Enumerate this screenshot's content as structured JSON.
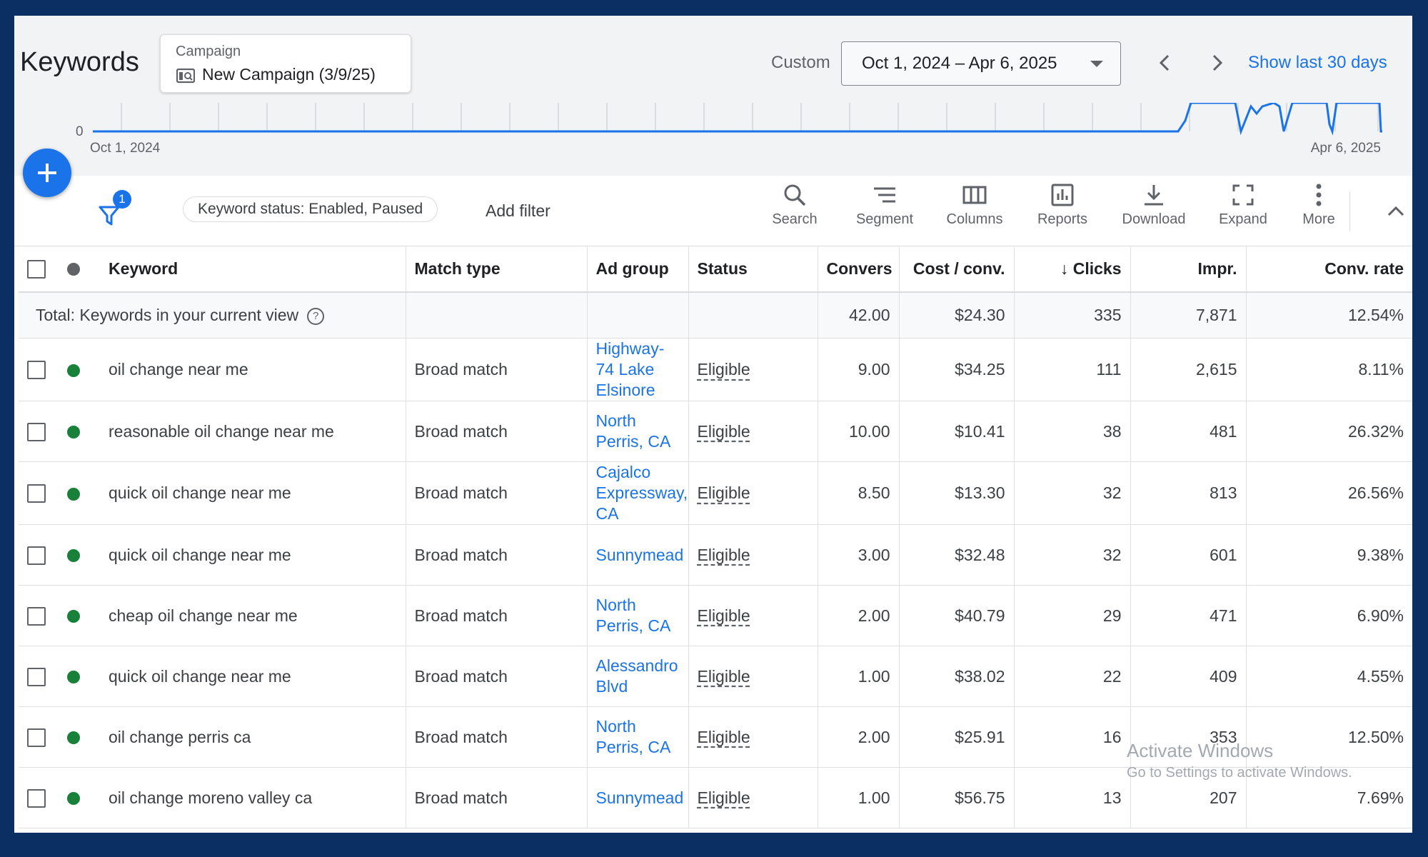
{
  "header": {
    "title": "Keywords",
    "campaign_label": "Campaign",
    "campaign_name": "New Campaign (3/9/25)",
    "custom_label": "Custom",
    "date_range": "Oct 1, 2024 – Apr 6, 2025",
    "show_last": "Show last 30 days"
  },
  "chart": {
    "y_zero": "0",
    "x_start": "Oct 1, 2024",
    "x_end": "Apr 6, 2025",
    "line_color": "#1a73e8"
  },
  "toolbar": {
    "filter_count": "1",
    "filter_chip": "Keyword status: Enabled, Paused",
    "add_filter": "Add filter",
    "tools": [
      "Search",
      "Segment",
      "Columns",
      "Reports",
      "Download",
      "Expand",
      "More"
    ]
  },
  "table": {
    "columns": [
      "Keyword",
      "Match type",
      "Ad group",
      "Status",
      "Convers",
      "Cost / conv.",
      "Clicks",
      "Impr.",
      "Conv. rate"
    ],
    "total": {
      "label": "Total: Keywords in your current view",
      "conversions": "42.00",
      "cost_conv": "$24.30",
      "clicks": "335",
      "impr": "7,871",
      "conv_rate": "12.54%"
    },
    "rows": [
      {
        "keyword": "oil change near me",
        "match": "Broad match",
        "ad_group": "Highway-74 Lake Elsinore",
        "status": "Eligible",
        "conv": "9.00",
        "cost": "$34.25",
        "clicks": "111",
        "impr": "2,615",
        "rate": "8.11%"
      },
      {
        "keyword": "reasonable oil change near me",
        "match": "Broad match",
        "ad_group": "North Perris, CA",
        "status": "Eligible",
        "conv": "10.00",
        "cost": "$10.41",
        "clicks": "38",
        "impr": "481",
        "rate": "26.32%"
      },
      {
        "keyword": "quick oil change near me",
        "match": "Broad match",
        "ad_group": "Cajalco Expressway, CA",
        "status": "Eligible",
        "conv": "8.50",
        "cost": "$13.30",
        "clicks": "32",
        "impr": "813",
        "rate": "26.56%"
      },
      {
        "keyword": "quick oil change near me",
        "match": "Broad match",
        "ad_group": "Sunnymead",
        "status": "Eligible",
        "conv": "3.00",
        "cost": "$32.48",
        "clicks": "32",
        "impr": "601",
        "rate": "9.38%"
      },
      {
        "keyword": "cheap oil change near me",
        "match": "Broad match",
        "ad_group": "North Perris, CA",
        "status": "Eligible",
        "conv": "2.00",
        "cost": "$40.79",
        "clicks": "29",
        "impr": "471",
        "rate": "6.90%"
      },
      {
        "keyword": "quick oil change near me",
        "match": "Broad match",
        "ad_group": "Alessandro Blvd",
        "status": "Eligible",
        "conv": "1.00",
        "cost": "$38.02",
        "clicks": "22",
        "impr": "409",
        "rate": "4.55%"
      },
      {
        "keyword": "oil change perris ca",
        "match": "Broad match",
        "ad_group": "North Perris, CA",
        "status": "Eligible",
        "conv": "2.00",
        "cost": "$25.91",
        "clicks": "16",
        "impr": "353",
        "rate": "12.50%"
      },
      {
        "keyword": "oil change moreno valley ca",
        "match": "Broad match",
        "ad_group": "Sunnymead",
        "status": "Eligible",
        "conv": "1.00",
        "cost": "$56.75",
        "clicks": "13",
        "impr": "207",
        "rate": "7.69%"
      }
    ]
  },
  "watermark": {
    "line1": "Activate Windows",
    "line2": "Go to Settings to activate Windows."
  }
}
